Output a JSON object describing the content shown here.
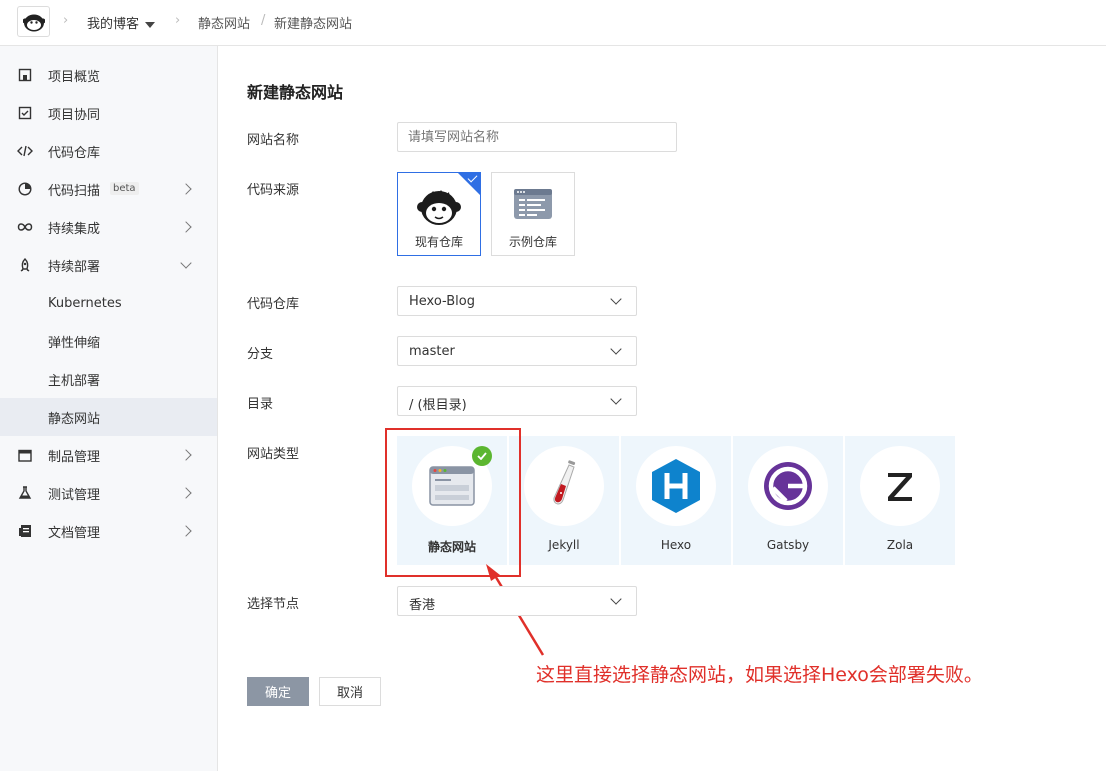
{
  "breadcrumb": {
    "project": "我的博客",
    "section": "静态网站",
    "current": "新建静态网站"
  },
  "sidebar": {
    "items": [
      {
        "label": "项目概览",
        "icon": "home-icon"
      },
      {
        "label": "项目协同",
        "icon": "checklist-icon"
      },
      {
        "label": "代码仓库",
        "icon": "code-icon"
      },
      {
        "label": "代码扫描",
        "icon": "scan-icon",
        "badge": "beta"
      },
      {
        "label": "持续集成",
        "icon": "infinity-icon"
      },
      {
        "label": "持续部署",
        "icon": "rocket-icon"
      },
      {
        "label": "Kubernetes"
      },
      {
        "label": "弹性伸缩"
      },
      {
        "label": "主机部署"
      },
      {
        "label": "静态网站"
      },
      {
        "label": "制品管理",
        "icon": "package-icon"
      },
      {
        "label": "测试管理",
        "icon": "flask-icon"
      },
      {
        "label": "文档管理",
        "icon": "document-icon"
      }
    ]
  },
  "form": {
    "title": "新建静态网站",
    "site_name_label": "网站名称",
    "site_name_placeholder": "请填写网站名称",
    "code_source_label": "代码来源",
    "code_sources": [
      {
        "label": "现有仓库",
        "icon": "monkey-icon",
        "selected": true
      },
      {
        "label": "示例仓库",
        "icon": "template-icon",
        "selected": false
      }
    ],
    "repo_label": "代码仓库",
    "repo_value": "Hexo-Blog",
    "branch_label": "分支",
    "branch_value": "master",
    "dir_label": "目录",
    "dir_value": "/ (根目录)",
    "site_type_label": "网站类型",
    "site_types": [
      {
        "label": "静态网站",
        "icon": "browser-window-icon",
        "selected": true
      },
      {
        "label": "Jekyll",
        "icon": "jekyll-icon",
        "selected": false
      },
      {
        "label": "Hexo",
        "icon": "hexo-icon",
        "selected": false
      },
      {
        "label": "Gatsby",
        "icon": "gatsby-icon",
        "selected": false
      },
      {
        "label": "Zola",
        "icon": "zola-icon",
        "selected": false
      }
    ],
    "node_label": "选择节点",
    "node_value": "香港",
    "confirm": "确定",
    "cancel": "取消"
  },
  "annotation": "这里直接选择静态网站，如果选择Hexo会部署失败。",
  "colors": {
    "accent": "#2f6fe4",
    "annotation_red": "#e0302a",
    "check_green": "#5bb630",
    "hexo_blue": "#0e83cd",
    "gatsby_purple": "#663399"
  }
}
